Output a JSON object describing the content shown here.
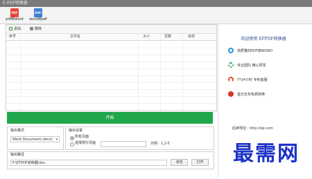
{
  "window": {
    "title": "E-PDF转换器"
  },
  "ribbon": {
    "items": [
      {
        "label": "pdf转word",
        "icon": "pdf-file-icon",
        "badge": "PDF",
        "color": "#e8443a"
      },
      {
        "label": "word转pdf",
        "icon": "doc-file-icon",
        "badge": "DOC",
        "color": "#3c7fd6"
      }
    ]
  },
  "toolbar": {
    "add_label": "添加",
    "delete_label": "删除"
  },
  "table": {
    "columns": [
      "序号",
      "文件名",
      "大小",
      "页数",
      "状态"
    ],
    "rows": []
  },
  "start_button": {
    "label": "开始"
  },
  "output_format": {
    "label": "输出格式",
    "value": "Word Document(.docx)"
  },
  "output_settings": {
    "label": "输出设置",
    "option_all": "所有页面",
    "option_select": "选择部分页面",
    "hint": "示例：1,2-5"
  },
  "output_path": {
    "label": "输出路径",
    "value": "F:\\ETPDF转换器\\doc",
    "browse_label": "浏览",
    "open_label": "打开"
  },
  "sidebar": {
    "title": "欢迎使用 EPPDF转换器",
    "features": [
      {
        "text": "高质量的PDF转WORD",
        "icon": "refresh-icon",
        "color": "#2a8fd8"
      },
      {
        "text": "专业团队 精心研发",
        "icon": "gear-icon",
        "color": "#2e9e4a"
      },
      {
        "text": "7*24小时 专利客服",
        "icon": "headset-icon",
        "color": "#e0552e"
      },
      {
        "text": "首次全年免费转换",
        "icon": "no-fee-icon",
        "color": "#d9342b"
      }
    ],
    "contact": "后续地址：http://ep.com"
  },
  "watermark": {
    "text": "最需网"
  }
}
